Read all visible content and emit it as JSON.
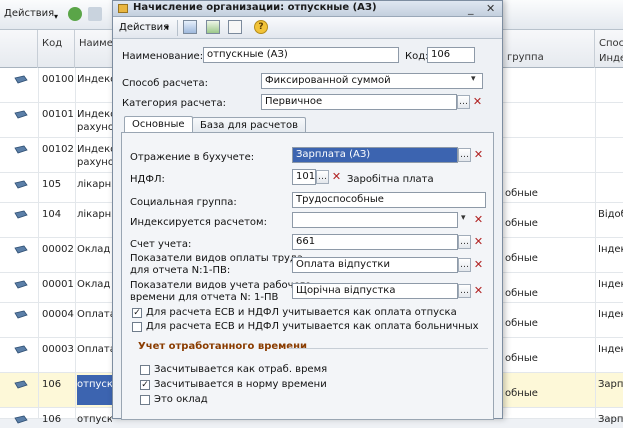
{
  "bg": {
    "toolbar": {
      "actions_label": "Действия"
    },
    "columns": {
      "code": "Код",
      "name": "Наимен",
      "group_header": "Спос",
      "group_sub": "группа",
      "index_sub": "Инде"
    },
    "rows": [
      {
        "code": "00100",
        "name": "Индекса",
        "name2": "",
        "group": "",
        "extra": ""
      },
      {
        "code": "00101",
        "name": "Индекса",
        "name2": "рахунок",
        "group": "",
        "extra": ""
      },
      {
        "code": "00102",
        "name": "Индекса",
        "name2": "рахунок",
        "group": "",
        "extra": ""
      },
      {
        "code": "105",
        "name": "лікарня",
        "name2": "",
        "group": "обные",
        "extra": ""
      },
      {
        "code": "104",
        "name": "лікарня",
        "name2": "",
        "group": "обные",
        "extra": "Відоб"
      },
      {
        "code": "00002",
        "name": "Оклад г",
        "name2": "",
        "group": "обные",
        "extra": "Індек"
      },
      {
        "code": "00001",
        "name": "Оклад г",
        "name2": "",
        "group": "обные",
        "extra": "Індек"
      },
      {
        "code": "00004",
        "name": "Оплата",
        "name2": "",
        "group": "обные",
        "extra": "Індек"
      },
      {
        "code": "00003",
        "name": "Оплата",
        "name2": "",
        "group": "обные",
        "extra": "Індек"
      },
      {
        "code": "106",
        "name": "отпускн",
        "name2": "",
        "group": "обные",
        "extra": "Зарпл"
      },
      {
        "code": "106",
        "name": "отпускн",
        "name2": "",
        "group": "",
        "extra": "Зарпл"
      }
    ]
  },
  "dialog": {
    "title": "Начисление организации: отпускные (АЗ)",
    "actions_label": "Действия",
    "help_label": "?",
    "name_label": "Наименование:",
    "name_value": "отпускные (АЗ)",
    "code_label": "Код:",
    "code_value": "106",
    "calc_method_label": "Способ расчета:",
    "calc_method_value": "Фиксированной суммой",
    "calc_category_label": "Категория расчета:",
    "calc_category_value": "Первичное",
    "tabs": [
      "Основные",
      "База для расчетов"
    ],
    "accounting_label": "Отражение в бухучете:",
    "accounting_value": "Зарплата (АЗ)",
    "ndfl_label": "НДФЛ:",
    "ndfl_code": "101",
    "ndfl_desc": "Заробітна плата",
    "social_group_label": "Социальная группа:",
    "social_group_value": "Трудоспособные",
    "indexed_label": "Индексируется расчетом:",
    "indexed_value": "",
    "account_label": "Счет учета:",
    "account_value": "661",
    "pay_indicators_label_1": "Показатели видов оплаты труда",
    "pay_indicators_label_2": "для отчета N:1-ПВ:",
    "pay_indicators_value": "Оплата відпустки",
    "time_indicators_label_1": "Показатели видов учета рабочего",
    "time_indicators_label_2": "времени для отчета N: 1-ПВ",
    "time_indicators_value": "Щорічна відпустка",
    "esv_vacation_label": "Для расчета ЕСВ и НДФЛ учитывается как оплата отпуска",
    "esv_vacation_checked": true,
    "esv_sick_label": "Для расчета ЕСВ и НДФЛ учитывается как оплата больничных",
    "esv_sick_checked": false,
    "worked_time_section": "Учет отработанного времени",
    "counted_worked_label": "Засчитывается как отраб. время",
    "counted_worked_checked": false,
    "counted_norm_label": "Засчитывается в норму времени",
    "counted_norm_checked": true,
    "is_salary_label": "Это оклад",
    "is_salary_checked": false
  },
  "colors": {
    "selection": "#3c64b0",
    "section_title": "#8a3c00"
  }
}
